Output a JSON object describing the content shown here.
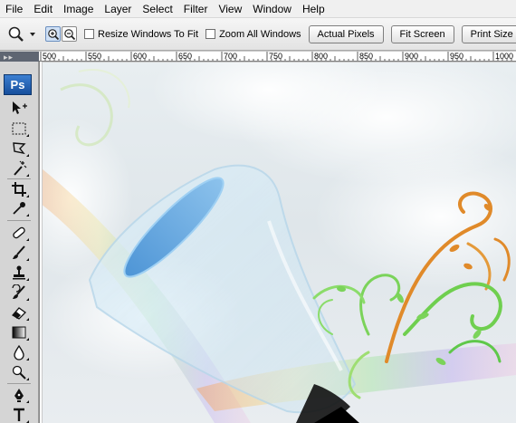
{
  "menu": [
    "File",
    "Edit",
    "Image",
    "Layer",
    "Select",
    "Filter",
    "View",
    "Window",
    "Help"
  ],
  "options": {
    "resize_windows_label": "Resize Windows To Fit",
    "resize_windows_checked": false,
    "zoom_all_label": "Zoom All Windows",
    "zoom_all_checked": false,
    "actual_pixels_label": "Actual Pixels",
    "fit_screen_label": "Fit Screen",
    "print_size_label": "Print Size"
  },
  "ruler": {
    "ticks": [
      "500",
      "550",
      "600",
      "650",
      "700",
      "750",
      "800",
      "850",
      "900",
      "950",
      "1000"
    ]
  },
  "tools": {
    "logo": "Ps",
    "items": [
      "move-tool",
      "marquee-tool",
      "lasso-tool",
      "magic-wand-tool",
      "crop-tool",
      "eyedropper-tool",
      "healing-brush-tool",
      "brush-tool",
      "clone-stamp-tool",
      "history-brush-tool",
      "eraser-tool",
      "gradient-tool",
      "blur-tool",
      "dodge-tool",
      "pen-tool",
      "type-tool"
    ]
  },
  "colors": {
    "glass_rim": "#6aa9de",
    "swirl_orange": "#e08a2a",
    "swirl_green": "#7bd35a",
    "sky": "#e4ebef"
  }
}
